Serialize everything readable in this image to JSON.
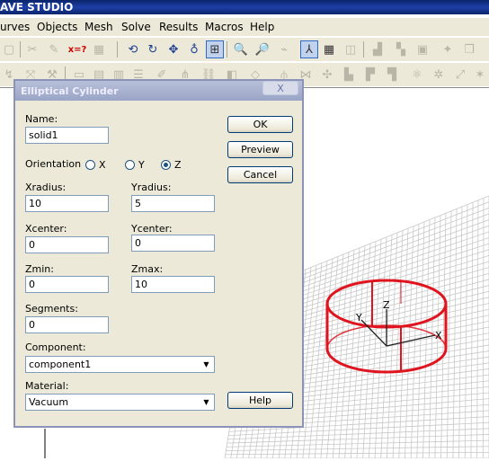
{
  "app": {
    "title": "AVE STUDIO"
  },
  "menu": [
    {
      "label": "urves"
    },
    {
      "label": "Objects"
    },
    {
      "label": "Mesh"
    },
    {
      "label": "Solve"
    },
    {
      "label": "Results"
    },
    {
      "label": "Macros"
    },
    {
      "label": "Help"
    }
  ],
  "dialog": {
    "title": "Elliptical Cylinder",
    "close_label": "X",
    "name_label": "Name:",
    "name_value": "solid1",
    "orientation_label": "Orientation",
    "orientation_options": [
      "X",
      "Y",
      "Z"
    ],
    "orientation_selected": "Z",
    "xradius_label": "Xradius:",
    "xradius_value": "10",
    "yradius_label": "Yradius:",
    "yradius_value": "5",
    "xcenter_label": "Xcenter:",
    "xcenter_value": "0",
    "ycenter_label": "Ycenter:",
    "ycenter_value": "0",
    "zmin_label": "Zmin:",
    "zmin_value": "0",
    "zmax_label": "Zmax:",
    "zmax_value": "10",
    "segments_label": "Segments:",
    "segments_value": "0",
    "component_label": "Component:",
    "component_value": "component1",
    "material_label": "Material:",
    "material_value": "Vacuum",
    "ok_label": "OK",
    "preview_label": "Preview",
    "cancel_label": "Cancel",
    "help_label": "Help"
  },
  "viewport": {
    "axis_labels": {
      "x": "X",
      "y": "Y",
      "z": "Z"
    },
    "shape_color": "#e0141e",
    "grid_color": "#c8c8c8"
  }
}
